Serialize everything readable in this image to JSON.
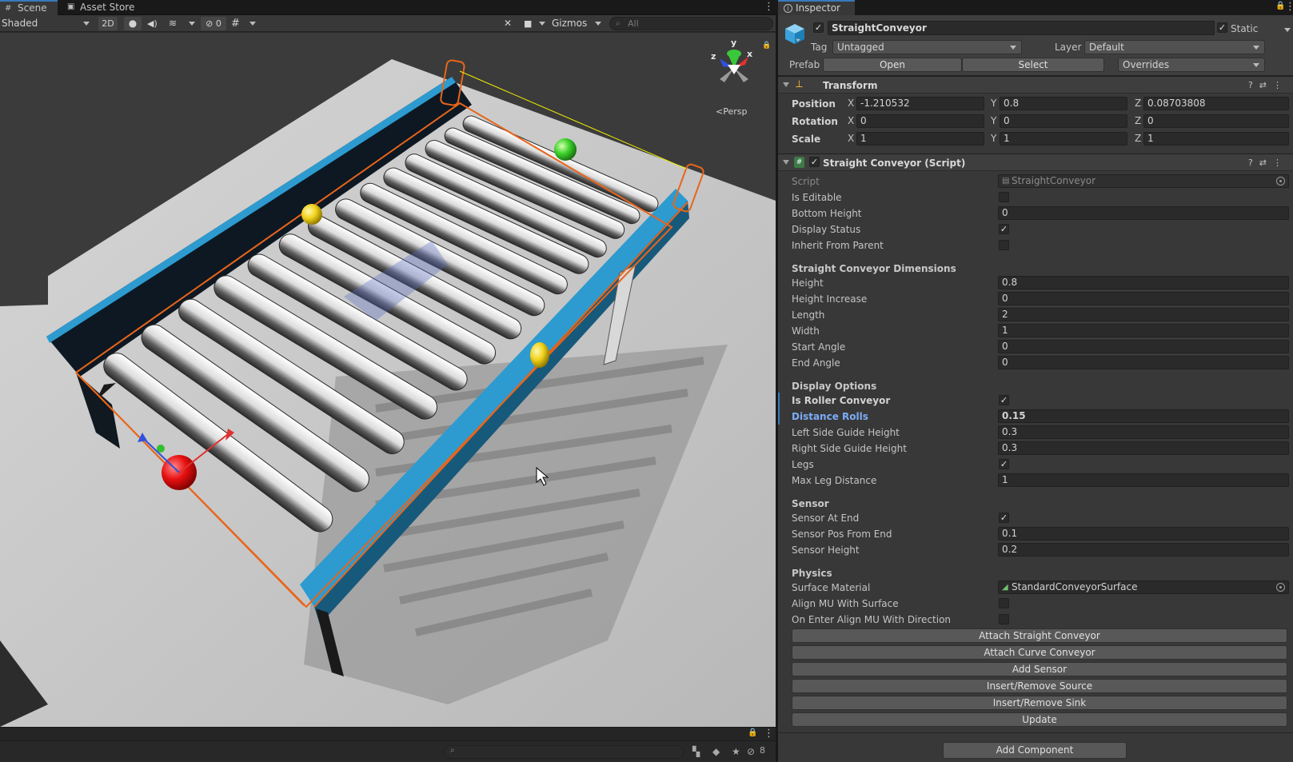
{
  "scene": {
    "tabs": [
      {
        "label": "Scene",
        "icon": "grid-icon"
      },
      {
        "label": "Asset Store",
        "icon": "bag-icon"
      }
    ],
    "toolbar": {
      "shading_mode": "Shaded",
      "mode_2d": "2D",
      "hidden_count": "0",
      "gizmos_label": "Gizmos",
      "search_placeholder": "All"
    },
    "gizmo": {
      "y": "y",
      "z": "z",
      "x": "x",
      "persp_label": "Persp"
    },
    "bottom_hidden_count": "8"
  },
  "inspector": {
    "tab_label": "Inspector",
    "object": {
      "name": "StraightConveyor",
      "active": true,
      "static_label": "Static",
      "tag_label": "Tag",
      "tag_value": "Untagged",
      "layer_label": "Layer",
      "layer_value": "Default",
      "prefab_label": "Prefab",
      "prefab_open": "Open",
      "prefab_select": "Select",
      "prefab_overrides": "Overrides"
    },
    "transform": {
      "title": "Transform",
      "rows": [
        {
          "label": "Position",
          "x": "-1.210532",
          "y": "0.8",
          "z": "0.08703808"
        },
        {
          "label": "Rotation",
          "x": "0",
          "y": "0",
          "z": "0"
        },
        {
          "label": "Scale",
          "x": "1",
          "y": "1",
          "z": "1"
        }
      ],
      "axis_x": "X",
      "axis_y": "Y",
      "axis_z": "Z"
    },
    "script_component": {
      "title": "Straight Conveyor (Script)",
      "script_label": "Script",
      "script_value": "StraightConveyor",
      "is_editable_label": "Is Editable",
      "bottom_height_label": "Bottom Height",
      "bottom_height_value": "0",
      "display_status_label": "Display Status",
      "inherit_label": "Inherit From Parent",
      "dimensions_header": "Straight Conveyor Dimensions",
      "height_label": "Height",
      "height_value": "0.8",
      "height_increase_label": "Height Increase",
      "height_increase_value": "0",
      "length_label": "Length",
      "length_value": "2",
      "width_label": "Width",
      "width_value": "1",
      "start_angle_label": "Start Angle",
      "start_angle_value": "0",
      "end_angle_label": "End Angle",
      "end_angle_value": "0",
      "display_header": "Display Options",
      "roller_label": "Is Roller Conveyor",
      "distance_rolls_label": "Distance Rolls",
      "distance_rolls_value": "0.15",
      "left_guide_label": "Left Side Guide Height",
      "left_guide_value": "0.3",
      "right_guide_label": "Right Side Guide Height",
      "right_guide_value": "0.3",
      "legs_label": "Legs",
      "max_leg_label": "Max Leg Distance",
      "max_leg_value": "1",
      "sensor_header": "Sensor",
      "sensor_at_end_label": "Sensor At End",
      "sensor_pos_label": "Sensor Pos From End",
      "sensor_pos_value": "0.1",
      "sensor_height_label": "Sensor Height",
      "sensor_height_value": "0.2",
      "physics_header": "Physics",
      "surface_label": "Surface Material",
      "surface_value": "StandardConveyorSurface",
      "align_label": "Align MU With Surface",
      "on_enter_label": "On Enter Align MU With Direction",
      "buttons": [
        "Attach Straight Conveyor",
        "Attach Curve Conveyor",
        "Add Sensor",
        "Insert/Remove Source",
        "Insert/Remove Sink",
        "Update"
      ]
    },
    "add_component": "Add Component"
  }
}
